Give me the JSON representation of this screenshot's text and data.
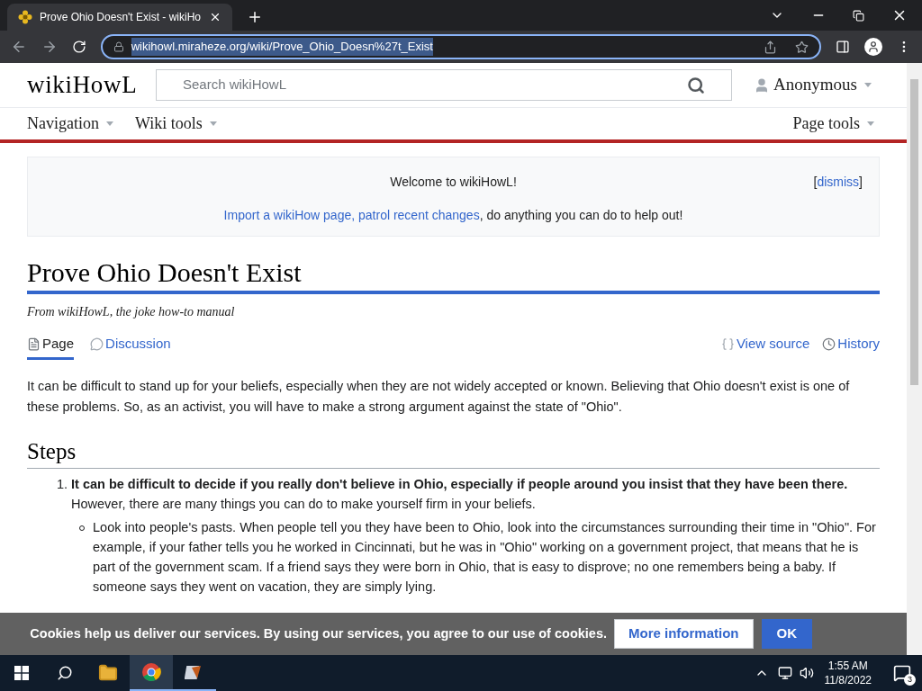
{
  "browser": {
    "tab_title": "Prove Ohio Doesn't Exist - wikiHo",
    "url": "wikihowl.miraheze.org/wiki/Prove_Ohio_Doesn%27t_Exist"
  },
  "header": {
    "logo": "wikiHowL",
    "search": {
      "placeholder": "Search wikiHowL"
    },
    "user": "Anonymous"
  },
  "nav": {
    "menus": [
      "Navigation",
      "Wiki tools"
    ],
    "right_menu": "Page tools"
  },
  "notice": {
    "title": "Welcome to wikiHowL!",
    "links": [
      "Import a wikiHow page",
      "patrol recent changes"
    ],
    "separator": ", ",
    "text": ", do anything you can do to help out!",
    "dismiss_open": "[",
    "dismiss": "dismiss",
    "dismiss_close": "]"
  },
  "article": {
    "title": "Prove Ohio Doesn't Exist",
    "tagline": "From wikiHowL, the joke how-to manual",
    "tabs": [
      {
        "label": "Page",
        "selected": true
      },
      {
        "label": "Discussion",
        "selected": false
      }
    ],
    "actions": [
      "View source",
      "History"
    ],
    "intro": "It can be difficult to stand up for your beliefs, especially when they are not widely accepted or known. Believing that Ohio doesn't exist is one of these problems. So, as an activist, you will have to make a strong argument against the state of \"Ohio\".",
    "section": "Steps",
    "steps": [
      {
        "number": "1.",
        "text": "**It can be difficult to decide if you really don't believe in Ohio, especially if people around you insist that they have been there.**  However, there are many things you can do to make yourself firm in your beliefs.",
        "bullets": [
          "Look into people's pasts.  When people tell you they have been to Ohio, look into the circumstances surrounding their time in \"Ohio\".  For example, if your father tells you he worked in Cincinnati, but he was in \"Ohio\" working on a government project, that means that he is part of the government scam.  If a friend says they were born in Ohio, that is easy to disprove; no one remembers being a baby.  If someone says they went on vacation, they are simply lying."
        ]
      }
    ]
  },
  "cookie": {
    "text": "Cookies help us deliver our services. By using our services, you agree to our use of cookies.",
    "more": "More information",
    "ok": "OK"
  },
  "taskbar": {
    "time": "1:55 AM",
    "date": "11/8/2022",
    "notifications": "3"
  }
}
